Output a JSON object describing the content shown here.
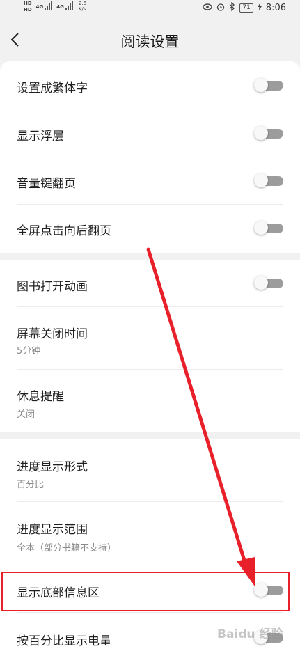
{
  "status_bar": {
    "left_tags": [
      "HD",
      "HD"
    ],
    "signal_labels": [
      "4G",
      "4G"
    ],
    "speed_value": "2.6",
    "speed_unit": "K/s",
    "battery": "71",
    "time": "8:06"
  },
  "header": {
    "title": "阅读设置"
  },
  "settings": {
    "traditional_chinese": {
      "label": "设置成繁体字",
      "enabled": false
    },
    "floating_layer": {
      "label": "显示浮层",
      "enabled": false
    },
    "volume_key_turn": {
      "label": "音量键翻页",
      "enabled": false
    },
    "fullscreen_tap": {
      "label": "全屏点击向后翻页",
      "enabled": false
    },
    "book_open_animation": {
      "label": "图书打开动画",
      "enabled": false
    },
    "screen_off_time": {
      "label": "屏幕关闭时间",
      "value": "5分钟"
    },
    "rest_reminder": {
      "label": "休息提醒",
      "value": "关闭"
    },
    "progress_format": {
      "label": "进度显示形式",
      "value": "百分比"
    },
    "progress_range": {
      "label": "进度显示范围",
      "value": "全本（部分书籍不支持）"
    },
    "bottom_info": {
      "label": "显示底部信息区",
      "enabled": false
    },
    "battery_percent": {
      "label": "按百分比显示电量",
      "enabled": false
    }
  },
  "watermark": {
    "text": "Baidu 经验"
  },
  "colors": {
    "background": "#f1f1f1",
    "card": "#ffffff",
    "toggle_off": "#9c9c9c",
    "annotation_red": "#e8202a"
  }
}
